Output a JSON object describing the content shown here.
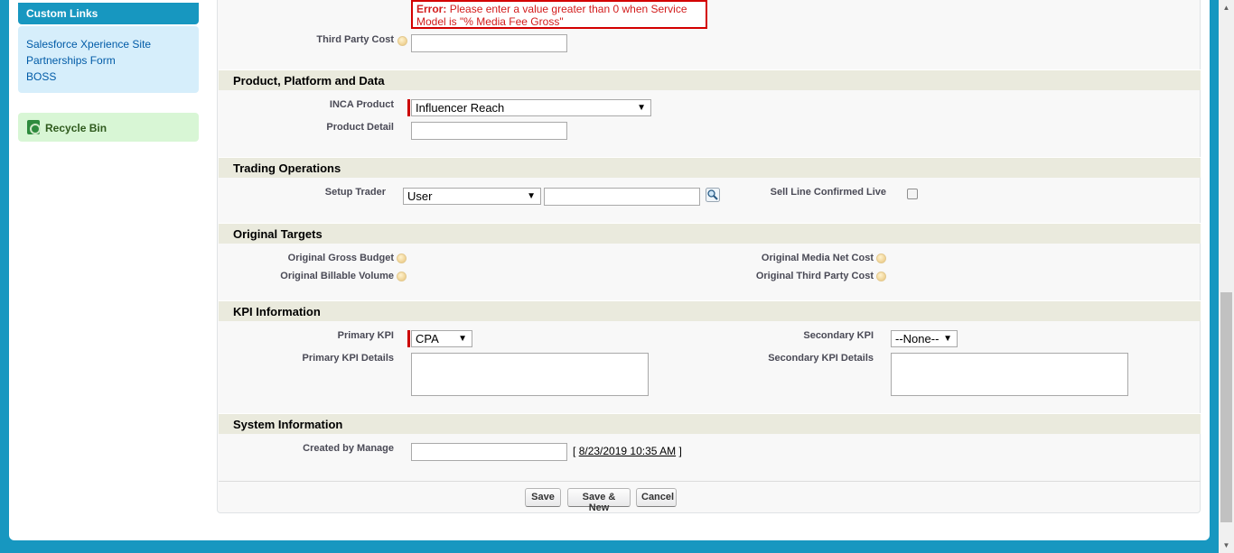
{
  "sidebar": {
    "custom_links_title": "Custom Links",
    "links": [
      "Salesforce Xperience Site",
      "Partnerships Form",
      "BOSS"
    ],
    "recycle_bin": "Recycle Bin"
  },
  "error": {
    "prefix": "Error:",
    "message": "Please enter a value greater than 0 when Service Model is \"% Media Fee Gross\""
  },
  "fields": {
    "third_party_cost": "Third Party Cost"
  },
  "sections": {
    "product": "Product, Platform and Data",
    "trading": "Trading Operations",
    "targets": "Original Targets",
    "kpi": "KPI Information",
    "system": "System Information"
  },
  "product": {
    "inca_label": "INCA Product",
    "inca_value": "Influencer Reach",
    "detail_label": "Product Detail"
  },
  "trading": {
    "setup_trader_label": "Setup Trader",
    "setup_trader_type": "User",
    "sell_line_label": "Sell Line Confirmed Live"
  },
  "targets": {
    "gross_budget": "Original Gross Budget",
    "billable_volume": "Original Billable Volume",
    "media_net_cost": "Original Media Net Cost",
    "third_party_cost": "Original Third Party Cost"
  },
  "kpi": {
    "primary_label": "Primary KPI",
    "primary_value": "CPA",
    "primary_details_label": "Primary KPI Details",
    "secondary_label": "Secondary KPI",
    "secondary_value": "--None--",
    "secondary_details_label": "Secondary KPI Details"
  },
  "system": {
    "created_by_label": "Created by Manage",
    "bracket_open": "[",
    "date": "8/23/2019 10:35 AM",
    "bracket_close": "]"
  },
  "buttons": {
    "save": "Save",
    "save_new": "Save & New",
    "cancel": "Cancel"
  },
  "icons": {
    "help": "help-icon",
    "lookup": "lookup-search-icon",
    "recycle": "recycle-bin-icon"
  }
}
